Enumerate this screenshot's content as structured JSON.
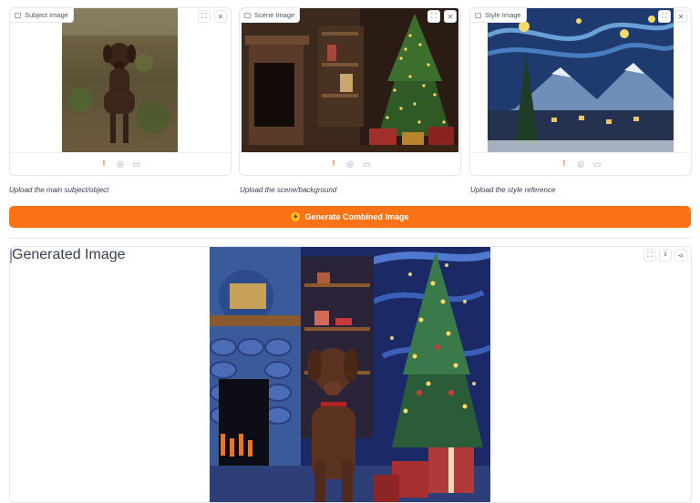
{
  "inputs": [
    {
      "label": "Subject Image",
      "caption": "Upload the main subject/object"
    },
    {
      "label": "Scene Image",
      "caption": "Upload the scene/background"
    },
    {
      "label": "Style Image",
      "caption": "Upload the style reference"
    }
  ],
  "generate_button": {
    "label": "Generate Combined Image"
  },
  "output": {
    "label": "Generated Image"
  },
  "colors": {
    "accent": "#f97316",
    "border": "#e5e7eb"
  }
}
